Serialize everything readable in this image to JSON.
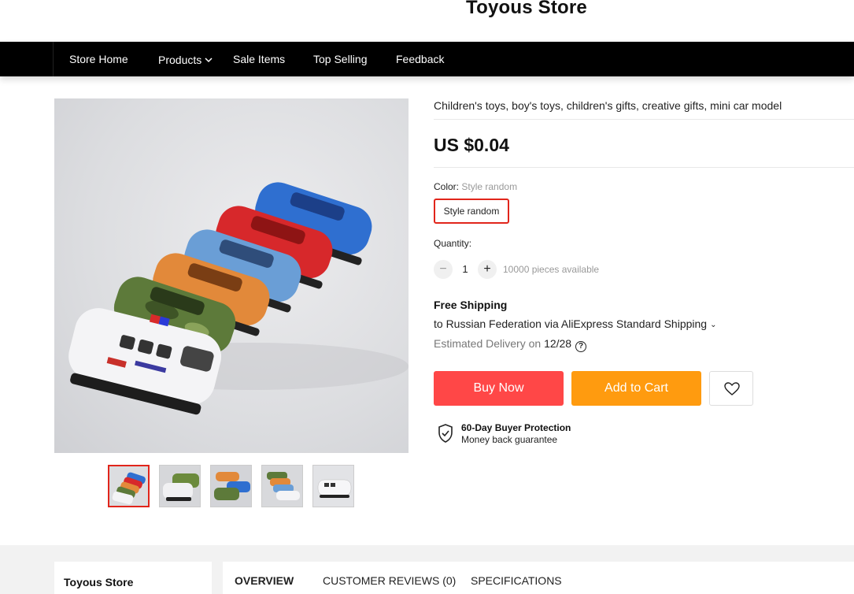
{
  "store": {
    "name": "Toyous Store"
  },
  "nav": {
    "items": [
      "Store Home",
      "Products",
      "Sale Items",
      "Top Selling",
      "Feedback"
    ]
  },
  "product": {
    "title": "Children's toys, boy's toys, children's gifts, creative gifts, mini car model",
    "price": "US $0.04",
    "color_label": "Color:",
    "color_value": "Style random",
    "color_option": "Style random",
    "quantity_label": "Quantity:",
    "quantity": "1",
    "available": "10000 pieces available",
    "shipping": {
      "title": "Free Shipping",
      "to": "to Russian Federation via AliExpress Standard Shipping",
      "estimated_label": "Estimated Delivery on",
      "estimated_date": "12/28"
    },
    "buy_now": "Buy Now",
    "add_to_cart": "Add to Cart",
    "protection": {
      "title": "60-Day Buyer Protection",
      "subtitle": "Money back guarantee"
    },
    "thumbnail_count": 5,
    "selected_thumbnail": 1
  },
  "colors": {
    "buy_now": "#ff4747",
    "add_to_cart": "#ff9b0f",
    "selection": "#e1251b"
  },
  "lower": {
    "store_name": "Toyous Store",
    "tabs": [
      "OVERVIEW",
      "CUSTOMER REVIEWS (0)",
      "SPECIFICATIONS"
    ]
  }
}
